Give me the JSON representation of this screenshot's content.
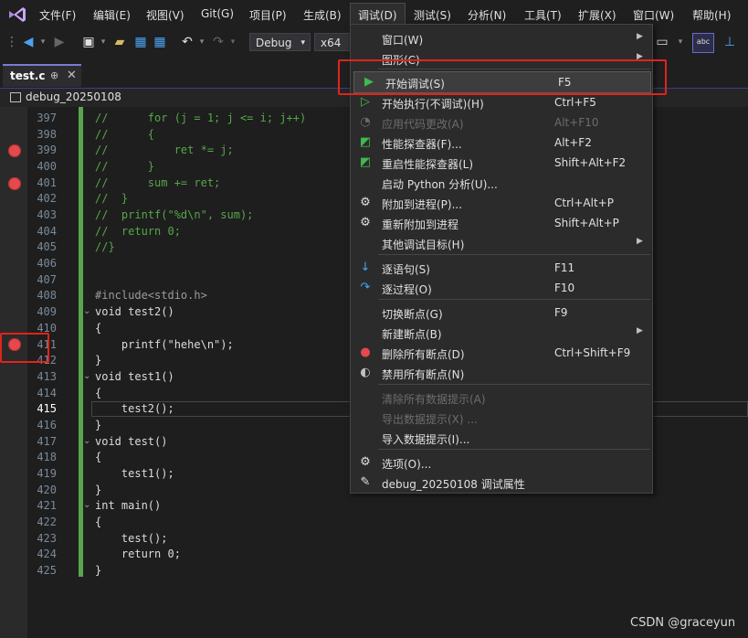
{
  "menubar": {
    "items": [
      "文件(F)",
      "编辑(E)",
      "视图(V)",
      "Git(G)",
      "项目(P)",
      "生成(B)",
      "调试(D)",
      "测试(S)",
      "分析(N)",
      "工具(T)",
      "扩展(X)",
      "窗口(W)",
      "帮助(H)"
    ]
  },
  "toolbar": {
    "config": "Debug",
    "platform": "x64"
  },
  "tab": {
    "label": "test.c",
    "pin": "⊕",
    "close": "✕"
  },
  "nav": {
    "project": "debug_20250108"
  },
  "code_lines": [
    {
      "n": "397",
      "t": "//      for (j = 1; j <= i; j++)"
    },
    {
      "n": "398",
      "t": "//      {"
    },
    {
      "n": "399",
      "t": "//          ret *= j;"
    },
    {
      "n": "400",
      "t": "//      }"
    },
    {
      "n": "401",
      "t": "//      sum += ret;"
    },
    {
      "n": "402",
      "t": "//  }"
    },
    {
      "n": "403",
      "t": "//  printf(\"%d\\n\", sum);"
    },
    {
      "n": "404",
      "t": "//  return 0;"
    },
    {
      "n": "405",
      "t": "//}"
    },
    {
      "n": "406",
      "t": ""
    },
    {
      "n": "407",
      "t": ""
    },
    {
      "n": "408",
      "t": "#include<stdio.h>"
    },
    {
      "n": "409",
      "t": "void test2()"
    },
    {
      "n": "410",
      "t": "{"
    },
    {
      "n": "411",
      "t": "    printf(\"hehe\\n\");"
    },
    {
      "n": "412",
      "t": "}"
    },
    {
      "n": "413",
      "t": "void test1()"
    },
    {
      "n": "414",
      "t": "{"
    },
    {
      "n": "415",
      "t": "    test2();"
    },
    {
      "n": "416",
      "t": "}"
    },
    {
      "n": "417",
      "t": "void test()"
    },
    {
      "n": "418",
      "t": "{"
    },
    {
      "n": "419",
      "t": "    test1();"
    },
    {
      "n": "420",
      "t": "}"
    },
    {
      "n": "421",
      "t": "int main()"
    },
    {
      "n": "422",
      "t": "{"
    },
    {
      "n": "423",
      "t": "    test();"
    },
    {
      "n": "424",
      "t": "    return 0;"
    },
    {
      "n": "425",
      "t": "}"
    }
  ],
  "debug_menu": {
    "items": [
      {
        "label": "窗口(W)",
        "shortcut": "",
        "submenu": true,
        "icon": "",
        "disabled": false
      },
      {
        "label": "图形(C)",
        "shortcut": "",
        "submenu": true,
        "icon": "",
        "disabled": false
      },
      {
        "label": "开始调试(S)",
        "shortcut": "F5",
        "submenu": false,
        "icon": "play-solid-icon",
        "disabled": false
      },
      {
        "label": "开始执行(不调试)(H)",
        "shortcut": "Ctrl+F5",
        "submenu": false,
        "icon": "play-outline-icon",
        "disabled": false
      },
      {
        "label": "应用代码更改(A)",
        "shortcut": "Alt+F10",
        "submenu": false,
        "icon": "flame-icon",
        "disabled": true
      },
      {
        "label": "性能探查器(F)...",
        "shortcut": "Alt+F2",
        "submenu": false,
        "icon": "profiler-icon",
        "disabled": false
      },
      {
        "label": "重启性能探查器(L)",
        "shortcut": "Shift+Alt+F2",
        "submenu": false,
        "icon": "profiler-restart-icon",
        "disabled": false
      },
      {
        "label": "启动 Python 分析(U)...",
        "shortcut": "",
        "submenu": false,
        "icon": "",
        "disabled": false
      },
      {
        "label": "附加到进程(P)...",
        "shortcut": "Ctrl+Alt+P",
        "submenu": false,
        "icon": "attach-gear-icon",
        "disabled": false
      },
      {
        "label": "重新附加到进程",
        "shortcut": "Shift+Alt+P",
        "submenu": false,
        "icon": "reattach-gear-icon",
        "disabled": false
      },
      {
        "label": "其他调试目标(H)",
        "shortcut": "",
        "submenu": true,
        "icon": "",
        "disabled": false
      },
      {
        "label": "逐语句(S)",
        "shortcut": "F11",
        "submenu": false,
        "icon": "step-into-icon",
        "disabled": false
      },
      {
        "label": "逐过程(O)",
        "shortcut": "F10",
        "submenu": false,
        "icon": "step-over-icon",
        "disabled": false
      },
      {
        "label": "切换断点(G)",
        "shortcut": "F9",
        "submenu": false,
        "icon": "",
        "disabled": false
      },
      {
        "label": "新建断点(B)",
        "shortcut": "",
        "submenu": true,
        "icon": "",
        "disabled": false
      },
      {
        "label": "删除所有断点(D)",
        "shortcut": "Ctrl+Shift+F9",
        "submenu": false,
        "icon": "delete-breakpoints-icon",
        "disabled": false
      },
      {
        "label": "禁用所有断点(N)",
        "shortcut": "",
        "submenu": false,
        "icon": "disable-breakpoints-icon",
        "disabled": false
      },
      {
        "label": "清除所有数据提示(A)",
        "shortcut": "",
        "submenu": false,
        "icon": "",
        "disabled": true
      },
      {
        "label": "导出数据提示(X) ...",
        "shortcut": "",
        "submenu": false,
        "icon": "",
        "disabled": true
      },
      {
        "label": "导入数据提示(I)...",
        "shortcut": "",
        "submenu": false,
        "icon": "",
        "disabled": false
      },
      {
        "label": "选项(O)...",
        "shortcut": "",
        "submenu": false,
        "icon": "gear-icon",
        "disabled": false
      },
      {
        "label": "debug_20250108 调试属性",
        "shortcut": "",
        "submenu": false,
        "icon": "wrench-icon",
        "disabled": false
      }
    ]
  },
  "watermark": "CSDN @graceyun",
  "colors": {
    "accent": "#68217a",
    "breakpoint": "#e5484d",
    "annotation": "#e0241c",
    "comment": "#57a64a",
    "keyword": "#569cd6"
  }
}
